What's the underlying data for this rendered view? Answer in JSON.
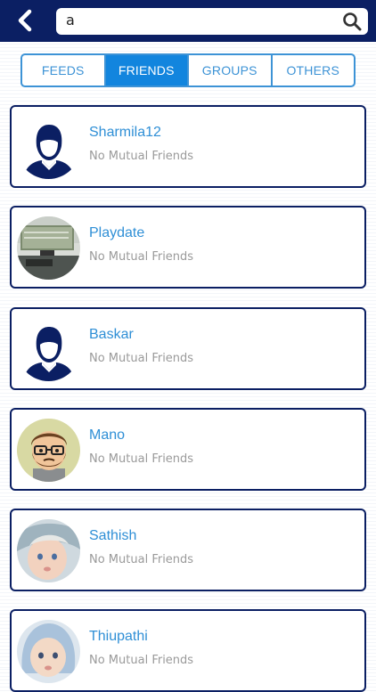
{
  "search": {
    "value": "a"
  },
  "tabs": [
    {
      "label": "FEEDS",
      "active": false
    },
    {
      "label": "FRIENDS",
      "active": true
    },
    {
      "label": "GROUPS",
      "active": false
    },
    {
      "label": "OTHERS",
      "active": false
    }
  ],
  "results": [
    {
      "name": "Sharmila12",
      "mutual": "No Mutual Friends",
      "avatar": "default-person-icon"
    },
    {
      "name": "Playdate",
      "mutual": "No Mutual Friends",
      "avatar": "photo-desk"
    },
    {
      "name": "Baskar",
      "mutual": "No Mutual Friends",
      "avatar": "default-person-icon"
    },
    {
      "name": "Mano",
      "mutual": "No Mutual Friends",
      "avatar": "cartoon-man"
    },
    {
      "name": "Sathish",
      "mutual": "No Mutual Friends",
      "avatar": "photo-baby"
    },
    {
      "name": "Thiupathi",
      "mutual": "No Mutual Friends",
      "avatar": "photo-baby-hood"
    }
  ],
  "colors": {
    "header": "#0b1f63",
    "accent": "#1285de",
    "name": "#2f8fd6"
  }
}
